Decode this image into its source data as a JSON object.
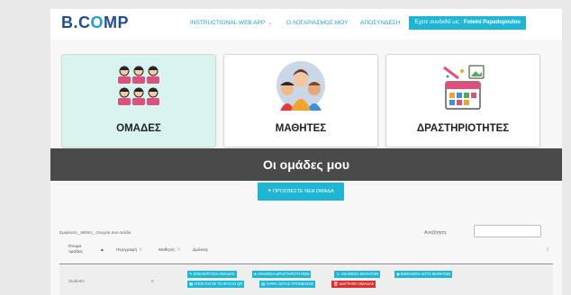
{
  "navbar": {
    "logo_prefix": "B.C",
    "logo_o": "O",
    "logo_suffix": "MP",
    "menu_app": "INSTRUCTIONAL WEB APP",
    "menu_account": "Ο ΛΟΓΑΡΙΑΣΜΟΣ ΜΟΥ",
    "menu_logout": "ΑΠΟΣΥΝΔΕΣΗ",
    "login_prefix": "Έχετε συνδεθεί ως :",
    "login_user": "Foteini Papadopoulou"
  },
  "cards": [
    {
      "label": "ΟΜΑΔΕΣ",
      "icon": "group-icon"
    },
    {
      "label": "ΜΑΘΗΤΕΣ",
      "icon": "students-icon"
    },
    {
      "label": "ΔΡΑΣΤΗΡΙΟΤΗΤΕΣ",
      "icon": "activities-icon"
    }
  ],
  "section": {
    "title": "Οι ομάδες μου"
  },
  "add_button": {
    "plus": "+",
    "label": "ΠΡΟΣΘΕΣΤΕ ΝΕΑ ΟΜΑΔΑ"
  },
  "table_controls": {
    "length_text": "Εμφάνιση _MENU_ στοιχεία ανα σελίδα",
    "search_label": "Αναζήτηση:"
  },
  "table": {
    "headers": [
      "Όνομα ομάδας",
      "Περιγραφή",
      "Μαθητές",
      "Δράσεις"
    ],
    "rows": [
      {
        "name": "Students",
        "description": "",
        "students": "0",
        "actions": [
          "ΕΠΕΞΕΡΓΑΣΙΑ ΟΜΑΔΑΣ",
          "ΑΝΑΘΕΣΗ ΔΡΑΣΤΗΡΙΟΤΗΤΩΝ",
          "ΑΝΑΘΕΣΗ ΜΑΘΗΤΩΝ",
          "ΕΜΦΑΝΙΣΗ ΛΙΣΤΑ ΜΑΘΗΤΩΝ",
          "ΑΠΟΚΤΗΣΤΕ ΤΟ ΦΥΛΛΟ QR",
          "ΛΗΨΗ ΛΙΣΤΑΣ ΠΡΟΣΒΑΣΗΣ",
          "ΔΙΑΓΡΑΦΗ ΟΜΑΔΑΣ"
        ]
      }
    ]
  },
  "colors": {
    "accent": "#1fb6d6",
    "brand": "#1f4f8c",
    "danger": "#d9302d",
    "section_bar": "#4a4a4a",
    "active_card": "#d9f3ee"
  }
}
